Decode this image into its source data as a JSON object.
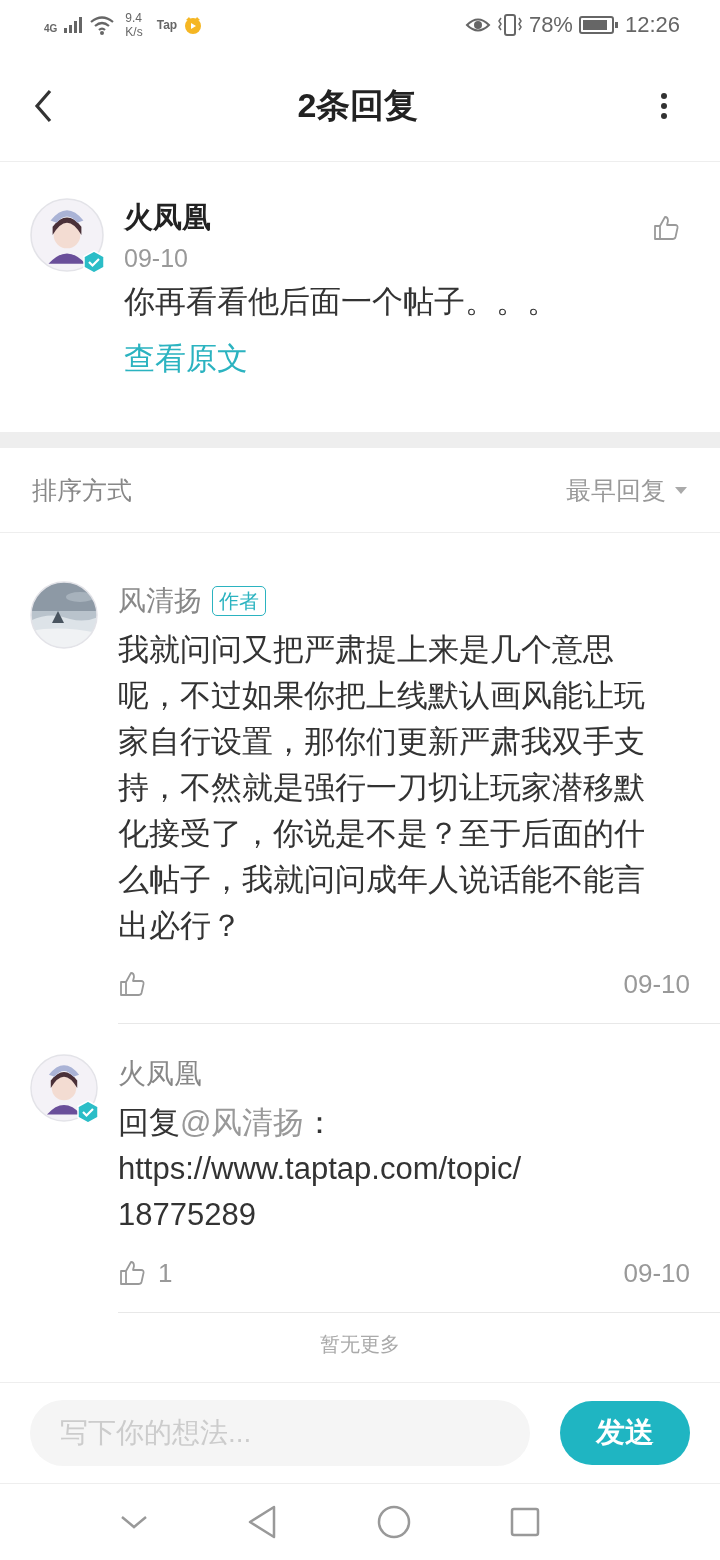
{
  "status_bar": {
    "network": "4G",
    "speed_value": "9.4",
    "speed_unit": "K/s",
    "app_badge": "Tap",
    "battery": "78%",
    "time": "12:26"
  },
  "header": {
    "title": "2条回复"
  },
  "comment": {
    "author": "火凤凰",
    "verified": true,
    "date": "09-10",
    "text": "你再看看他后面一个帖子。。。",
    "view_original": "查看原文",
    "liked": false
  },
  "sort": {
    "label": "排序方式",
    "value": "最早回复"
  },
  "replies": [
    {
      "author": "风清扬",
      "kind": "picture",
      "author_tag": "作者",
      "text": "我就问问又把严肃提上来是几个意思呢，不过如果你把上线默认画风能让玩家自行设置，那你们更新严肃我双手支持，不然就是强行一刀切让玩家潜移默化接受了，你说是不是？至于后面的什么帖子，我就问问成年人说话能不能言出必行？",
      "date": "09-10"
    },
    {
      "author": "火凤凰",
      "kind": "figure",
      "verified": true,
      "reply_prefix": "回复",
      "mention": "@风清扬",
      "reply_suffix": "：",
      "link": "https://www.taptap.com/topic/18775289",
      "likes": "1",
      "date": "09-10"
    }
  ],
  "end_note": "暂无更多",
  "composer": {
    "placeholder": "写下你的想法...",
    "send": "发送"
  }
}
